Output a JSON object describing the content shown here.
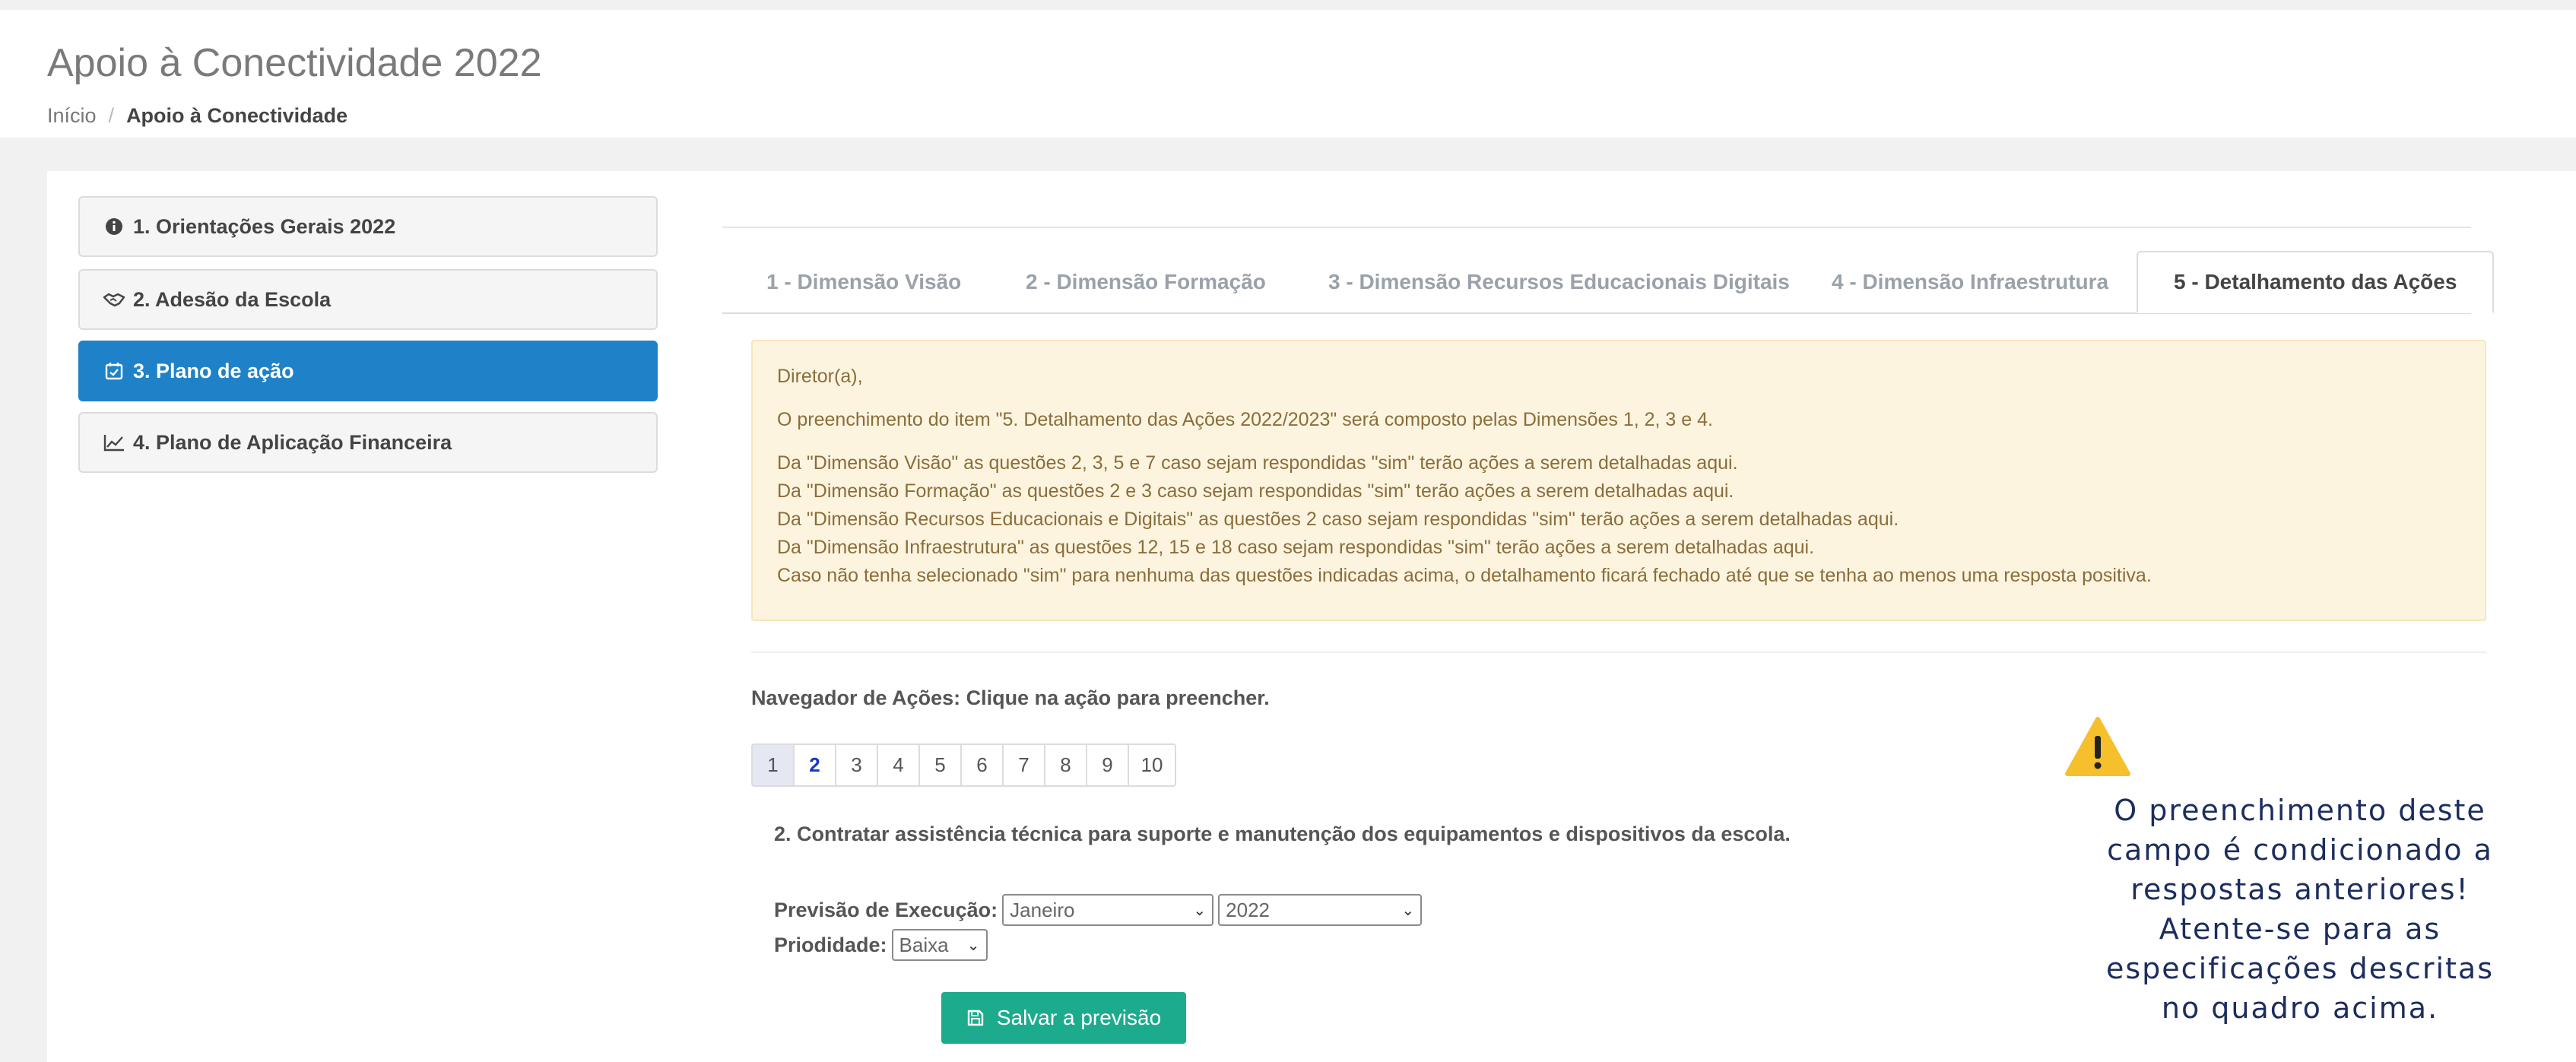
{
  "header": {
    "title": "Apoio à Conectividade 2022",
    "breadcrumb": {
      "home": "Início",
      "separator": "/",
      "current": "Apoio à Conectividade"
    }
  },
  "sidebar": {
    "items": [
      {
        "label": "1. Orientações Gerais 2022",
        "icon": "info-circle-icon",
        "active": false
      },
      {
        "label": "2. Adesão da Escola",
        "icon": "handshake-icon",
        "active": false
      },
      {
        "label": "3. Plano de ação",
        "icon": "calendar-check-icon",
        "active": true
      },
      {
        "label": "4. Plano de Aplicação Financeira",
        "icon": "line-chart-icon",
        "active": false
      }
    ]
  },
  "tabs": [
    {
      "label": "1 - Dimensão Visão",
      "active": false
    },
    {
      "label": "2 - Dimensão Formação",
      "active": false
    },
    {
      "label": "3 - Dimensão Recursos Educacionais Digitais",
      "active": false
    },
    {
      "label": "4 - Dimensão Infraestrutura",
      "active": false
    },
    {
      "label": "5 - Detalhamento das Ações",
      "active": true
    }
  ],
  "alert": {
    "greeting": "Diretor(a),",
    "intro": "O preenchimento do item \"5. Detalhamento das Ações 2022/2023\" será composto pelas Dimensões 1, 2, 3 e 4.",
    "lines": [
      "Da \"Dimensão Visão\" as questões 2, 3, 5 e 7 caso sejam respondidas \"sim\" terão ações a serem detalhadas aqui.",
      "Da \"Dimensão Formação\" as questões 2 e 3 caso sejam respondidas \"sim\" terão ações a serem detalhadas aqui.",
      "Da \"Dimensão Recursos Educacionais e Digitais\" as questões 2 caso sejam respondidas \"sim\" terão ações a serem detalhadas aqui.",
      "Da \"Dimensão Infraestrutura\" as questões 12, 15 e 18 caso sejam respondidas \"sim\" terão ações a serem detalhadas aqui.",
      "Caso não tenha selecionado \"sim\" para nenhuma das questões indicadas acima, o detalhamento ficará fechado até que se tenha ao menos uma resposta positiva."
    ],
    "color": "#8a6d3b"
  },
  "navigator": {
    "label": "Navegador de Ações: Clique na ação para preencher.",
    "pages": [
      "1",
      "2",
      "3",
      "4",
      "5",
      "6",
      "7",
      "8",
      "9",
      "10"
    ],
    "current": "2"
  },
  "action": {
    "title": "2. Contratar assistência técnica para suporte e manutenção dos equipamentos e dispositivos da escola.",
    "execution_label": "Previsão de Execução:",
    "month_value": "Janeiro",
    "year_value": "2022",
    "priority_label": "Priodidade:",
    "priority_value": "Baixa",
    "save_label": "Salvar a previsão",
    "save_color": "#1dab8d"
  },
  "warning": {
    "icon": "warning-icon",
    "lines": [
      "O preenchimento deste",
      "campo é condicionado a",
      "respostas anteriores!",
      "Atente-se para as",
      "especificações descritas",
      "no quadro acima."
    ],
    "color": "#1c2d5e"
  },
  "colors": {
    "accent": "#1f82c8",
    "success": "#1dab8d",
    "warning": "#f6c02c"
  }
}
